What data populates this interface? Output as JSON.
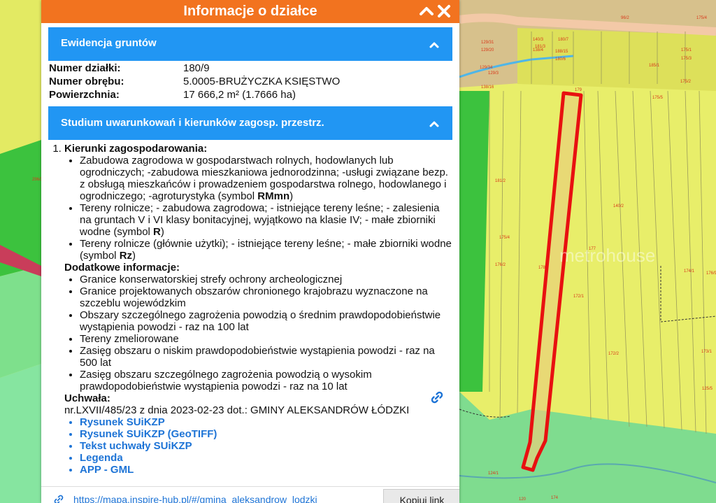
{
  "panel": {
    "title": "Informacje o działce",
    "collapse_icon": "chevron-up-icon",
    "close_icon": "close-icon"
  },
  "ewidencja": {
    "section_title": "Ewidencja gruntów",
    "rows": [
      {
        "label": "Numer działki:",
        "value": "180/9"
      },
      {
        "label": "Numer obrębu:",
        "value": "5.0005-BRUŻYCZKA KSIĘSTWO"
      },
      {
        "label": "Powierzchnia:",
        "value": "17 666,2 m² (1.7666 ha)"
      }
    ]
  },
  "studium": {
    "section_title": "Studium uwarunkowań i kierunków zagosp. przestrz.",
    "kierunki_heading": "Kierunki zagospodarowania:",
    "kierunki_items": [
      {
        "text": "Zabudowa zagrodowa w gospodarstwach rolnych, hodowlanych lub ogrodniczych; -zabudowa mieszkaniowa jednorodzinna; -usługi związane bezp. z obsługą mieszkańców i prowadzeniem gospodarstwa rolnego, hodowlanego i ogrodniczego; -agroturystyka (symbol ",
        "symbol": "RMmn",
        "tail": ")"
      },
      {
        "text": "Tereny rolnicze; - zabudowa zagrodowa; - istniejące tereny leśne; - zalesienia na gruntach V i VI klasy bonitacyjnej, wyjątkowo na klasie IV; - małe zbiorniki wodne (symbol ",
        "symbol": "R",
        "tail": ")"
      },
      {
        "text": "Tereny rolnicze (głównie użytki); - istniejące tereny leśne; - małe zbiorniki wodne (symbol ",
        "symbol": "Rz",
        "tail": ")"
      }
    ],
    "dodatkowe_heading": "Dodatkowe informacje:",
    "dodatkowe_items": [
      "Granice konserwatorskiej strefy ochrony archeologicznej",
      "Granice projektowanych obszarów chronionego krajobrazu wyznaczone na szczeblu wojewódzkim",
      "Obszary szczególnego zagrożenia powodzią o średnim prawdopodobieństwie wystąpienia powodzi - raz na 100 lat",
      "Tereny zmeliorowane",
      "Zasięg obszaru o niskim prawdopodobieństwie wystąpienia powodzi - raz na 500 lat",
      "Zasięg obszaru szczególnego zagrożenia powodzią o wysokim prawdopodobieństwie wystąpienia powodzi - raz na 10 lat"
    ],
    "uchwala_heading": "Uchwała:",
    "uchwala_text": "nr.LXVII/485/23 z dnia 2023-02-23 dot.: GMINY ALEKSANDRÓW ŁÓDZKI",
    "links": [
      "Rysunek SUiKZP",
      "Rysunek SUiKZP (GeoTIFF)",
      "Tekst uchwały SUiKZP",
      "Legenda",
      "APP - GML"
    ]
  },
  "share": {
    "url": "https://mapa.inspire-hub.pl/#/gmina_aleksandrow_lodzki",
    "copy_label": "Kopiuj link"
  },
  "map": {
    "watermark": "metrohouse",
    "parcel_labels": [
      "96/2",
      "175/4",
      "140/3",
      "181/3",
      "180/7",
      "175/1",
      "129/20",
      "129/31",
      "129/34",
      "138/4",
      "188/15",
      "180/6",
      "175/3",
      "185/1",
      "175/2",
      "129/3",
      "138/16",
      "179",
      "175/5",
      "181/2",
      "177",
      "140/2",
      "176/2",
      "178",
      "175/4",
      "172/1",
      "174/1",
      "176/9",
      "172/2",
      "173/1",
      "125/5",
      "124/1",
      "120",
      "174",
      "296/3"
    ],
    "colors": {
      "parcel_highlight": "#e81010",
      "agricultural": "#e7ee6a",
      "forest": "#7fdc8f",
      "settlement": "#d8c08f",
      "green": "#3bc03c"
    }
  }
}
